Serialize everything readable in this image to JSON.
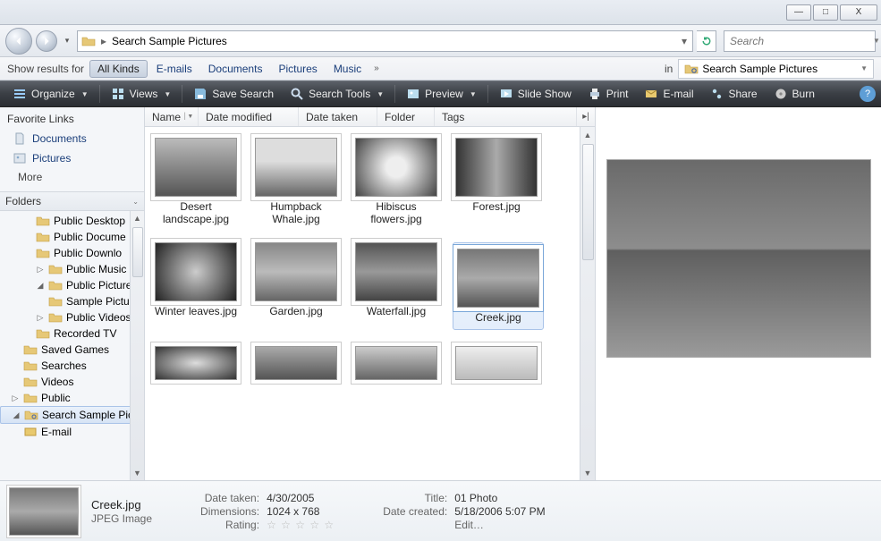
{
  "titlebar": {
    "min": "—",
    "max": "□",
    "close": "X"
  },
  "nav": {
    "path_text": "Search Sample Pictures",
    "search_placeholder": "Search"
  },
  "filter": {
    "label": "Show results for",
    "tabs": [
      "All Kinds",
      "E-mails",
      "Documents",
      "Pictures",
      "Music"
    ],
    "in_label": "in",
    "location": "Search Sample Pictures"
  },
  "cmd": {
    "organize": "Organize",
    "views": "Views",
    "savesearch": "Save Search",
    "searchtools": "Search Tools",
    "preview": "Preview",
    "slideshow": "Slide Show",
    "print": "Print",
    "email": "E-mail",
    "share": "Share",
    "burn": "Burn"
  },
  "fav": {
    "header": "Favorite Links",
    "documents": "Documents",
    "pictures": "Pictures",
    "more": "More"
  },
  "folders_header": "Folders",
  "tree": {
    "n0": "Public Desktop",
    "n1": "Public Docume",
    "n2": "Public Downlo",
    "n3": "Public Music",
    "n4": "Public Pictures",
    "n5": "Sample Pictu",
    "n6": "Public Videos",
    "n7": "Recorded TV",
    "n8": "Saved Games",
    "n9": "Searches",
    "n10": "Videos",
    "n11": "Public",
    "n12": "Search Sample Pict",
    "n13": "E-mail"
  },
  "columns": {
    "name": "Name",
    "datemod": "Date modified",
    "datetaken": "Date taken",
    "folder": "Folder",
    "tags": "Tags"
  },
  "items": {
    "i0": "Desert landscape.jpg",
    "i1": "Humpback Whale.jpg",
    "i2": "Hibiscus flowers.jpg",
    "i3": "Forest.jpg",
    "i4": "Winter leaves.jpg",
    "i5": "Garden.jpg",
    "i6": "Waterfall.jpg",
    "i7": "Creek.jpg"
  },
  "details": {
    "name": "Creek.jpg",
    "type": "JPEG Image",
    "lbl_datetaken": "Date taken:",
    "datetaken": "4/30/2005",
    "lbl_dimensions": "Dimensions:",
    "dimensions": "1024 x 768",
    "lbl_rating": "Rating:",
    "rating": "☆ ☆ ☆ ☆ ☆",
    "lbl_title": "Title:",
    "title": "01 Photo",
    "lbl_datecreated": "Date created:",
    "datecreated": "5/18/2006 5:07 PM",
    "edit": "Edit…"
  }
}
